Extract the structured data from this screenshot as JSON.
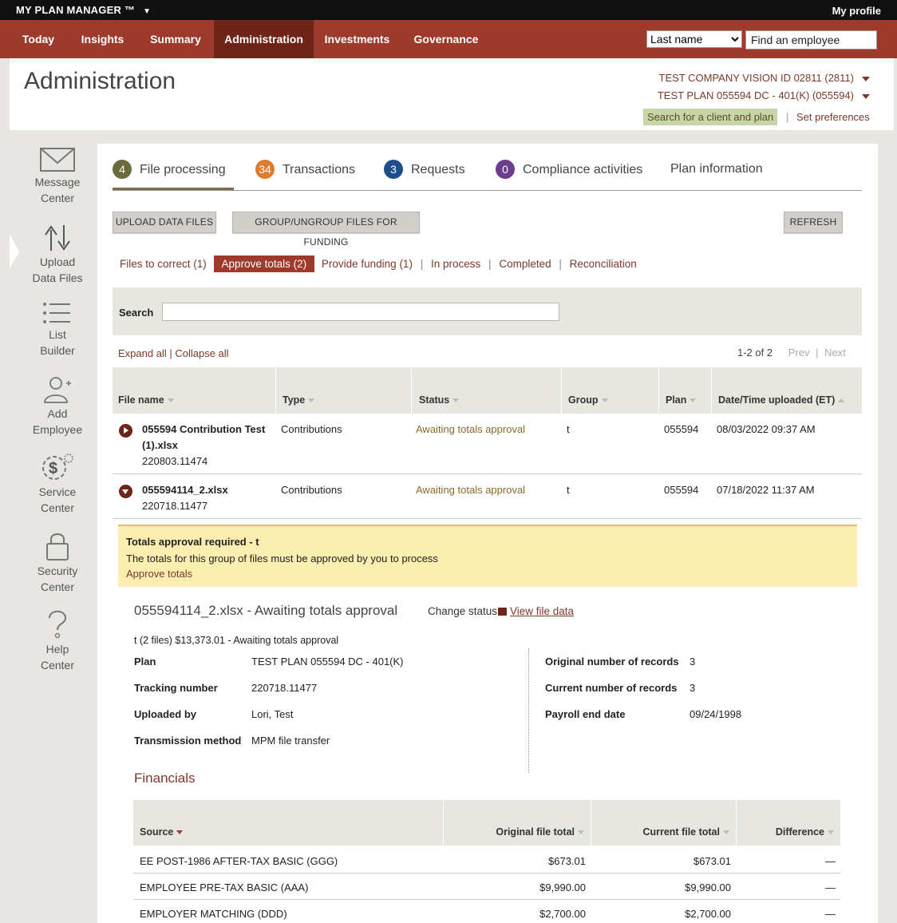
{
  "topbar": {
    "brand": "MY PLAN MANAGER ™",
    "brand_caret": "▼",
    "profile": "My profile"
  },
  "nav": {
    "items": [
      "Today",
      "Insights",
      "Summary",
      "Administration",
      "Investments",
      "Governance"
    ],
    "active": "Administration",
    "search_type": "Last name",
    "search_placeholder": "Find an employee"
  },
  "header": {
    "title": "Administration",
    "company": "TEST COMPANY VISION ID 02811 (2811)",
    "plan": "TEST PLAN 055594 DC - 401(K) (055594)",
    "search_client": "Search for a client and plan",
    "divider": "|",
    "set_preferences": "Set preferences"
  },
  "sidebar": {
    "items": [
      {
        "line1": "Message",
        "line2": "Center",
        "icon": "envelope-icon"
      },
      {
        "line1": "Upload",
        "line2": "Data Files",
        "icon": "upload-arrows-icon"
      },
      {
        "line1": "List",
        "line2": "Builder",
        "icon": "list-icon"
      },
      {
        "line1": "Add",
        "line2": "Employee",
        "icon": "add-person-icon"
      },
      {
        "line1": "Service",
        "line2": "Center",
        "icon": "dollar-gear-icon"
      },
      {
        "line1": "Security",
        "line2": "Center",
        "icon": "lock-icon"
      },
      {
        "line1": "Help",
        "line2": "Center",
        "icon": "question-icon"
      }
    ]
  },
  "tabs": [
    {
      "count": "4",
      "label": "File processing",
      "color": "#6b6a3f"
    },
    {
      "count": "34",
      "label": "Transactions",
      "color": "#e07b2e"
    },
    {
      "count": "3",
      "label": "Requests",
      "color": "#1f4e8c"
    },
    {
      "count": "0",
      "label": "Compliance activities",
      "color": "#6a3d8e"
    },
    {
      "count": "",
      "label": "Plan information",
      "color": ""
    }
  ],
  "buttons": {
    "upload": "UPLOAD DATA FILES",
    "group": "GROUP/UNGROUP FILES FOR FUNDING",
    "refresh": "REFRESH"
  },
  "subtabs": {
    "files_to_correct": "Files to correct (1)",
    "approve_totals": "Approve totals (2)",
    "provide_funding": "Provide funding (1)",
    "in_process": "In process",
    "completed": "Completed",
    "reconciliation": "Reconciliation",
    "sep": "|"
  },
  "search": {
    "label": "Search",
    "value": ""
  },
  "list_controls": {
    "expand_all": "Expand all",
    "sep": "|",
    "collapse_all": "Collapse all",
    "range": "1-2 of 2",
    "prev": "Prev",
    "next": "Next",
    "pager_sep": "|"
  },
  "table": {
    "columns": [
      "File name",
      "Type",
      "Status",
      "Group",
      "Plan",
      "Date/Time uploaded (ET)"
    ],
    "rows": [
      {
        "file_line1": "055594 Contribution Test",
        "file_line2": "(1).xlsx",
        "tracking": "220803.11474",
        "type": "Contributions",
        "status": "Awaiting totals approval",
        "group": "t",
        "plan": "055594",
        "uploaded": "08/03/2022 09:37 AM"
      },
      {
        "file_line1": "055594114_2.xlsx",
        "file_line2": "",
        "tracking": "220718.11477",
        "type": "Contributions",
        "status": "Awaiting totals approval",
        "group": "t",
        "plan": "055594",
        "uploaded": "07/18/2022 11:37 AM"
      }
    ]
  },
  "alert": {
    "title": "Totals approval required - t",
    "message": "The totals for this group of files must be approved by you to process",
    "link": "Approve totals"
  },
  "detail": {
    "title": "055594114_2.xlsx - Awaiting totals approval",
    "change_status": "Change status",
    "view_file_data": "View file data",
    "group_line": "t (2 files) $13,373.01 - Awaiting totals approval",
    "left": [
      {
        "key": "Plan",
        "value": "TEST PLAN 055594 DC - 401(K)"
      },
      {
        "key": "Tracking number",
        "value": "220718.11477"
      },
      {
        "key": "Uploaded by",
        "value": "Lori, Test"
      },
      {
        "key": "Transmission method",
        "value": "MPM file transfer"
      }
    ],
    "right": [
      {
        "key": "Original number of records",
        "value": "3"
      },
      {
        "key": "Current number of records",
        "value": "3"
      },
      {
        "key": "Payroll end date",
        "value": "09/24/1998"
      }
    ]
  },
  "financials": {
    "title": "Financials",
    "columns": [
      "Source",
      "Original file total",
      "Current file total",
      "Difference"
    ],
    "rows": [
      {
        "source": "EE POST-1986 AFTER-TAX BASIC (GGG)",
        "original": "$673.01",
        "current": "$673.01",
        "difference": "—"
      },
      {
        "source": "EMPLOYEE PRE-TAX BASIC (AAA)",
        "original": "$9,990.00",
        "current": "$9,990.00",
        "difference": "—"
      },
      {
        "source": "EMPLOYER MATCHING (DDD)",
        "original": "$2,700.00",
        "current": "$2,700.00",
        "difference": "—"
      }
    ]
  }
}
